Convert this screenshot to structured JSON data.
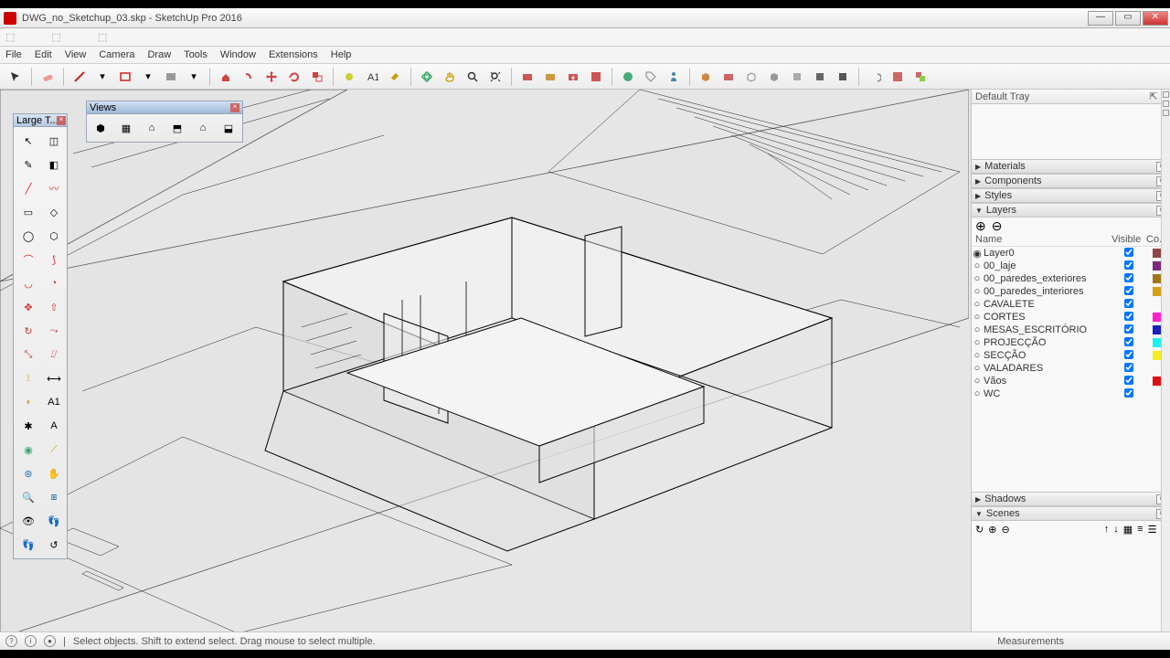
{
  "title": "DWG_no_Sketchup_03.skp - SketchUp Pro 2016",
  "menus": [
    "File",
    "Edit",
    "View",
    "Camera",
    "Draw",
    "Tools",
    "Window",
    "Extensions",
    "Help"
  ],
  "sidetool_title": "Large T...",
  "views_title": "Views",
  "tray_title": "Default Tray",
  "panels": {
    "materials": "Materials",
    "components": "Components",
    "styles": "Styles",
    "layers": "Layers",
    "shadows": "Shadows",
    "scenes": "Scenes"
  },
  "layer_columns": {
    "name": "Name",
    "visible": "Visible",
    "color": "Co..."
  },
  "layers": [
    {
      "name": "Layer0",
      "active": true,
      "visible": true,
      "color": "#904848"
    },
    {
      "name": "00_laje",
      "active": false,
      "visible": true,
      "color": "#7a2c7a"
    },
    {
      "name": "00_paredes_exteriores",
      "active": false,
      "visible": true,
      "color": "#a07818"
    },
    {
      "name": "00_paredes_interiores",
      "active": false,
      "visible": true,
      "color": "#d8a018"
    },
    {
      "name": "CAVALETE",
      "active": false,
      "visible": true,
      "color": ""
    },
    {
      "name": "CORTES",
      "active": false,
      "visible": true,
      "color": "#ff20cc"
    },
    {
      "name": "MESAS_ESCRITÓRIO",
      "active": false,
      "visible": true,
      "color": "#1820c0"
    },
    {
      "name": "PROJECÇÃO",
      "active": false,
      "visible": true,
      "color": "#20f0f0"
    },
    {
      "name": "SECÇÃO",
      "active": false,
      "visible": true,
      "color": "#f0f020"
    },
    {
      "name": "VALADARES",
      "active": false,
      "visible": true,
      "color": ""
    },
    {
      "name": "Vãos",
      "active": false,
      "visible": true,
      "color": "#e01010"
    },
    {
      "name": "WC",
      "active": false,
      "visible": true,
      "color": ""
    }
  ],
  "status_hint": "Select objects. Shift to extend select. Drag mouse to select multiple.",
  "measurements_label": "Measurements"
}
